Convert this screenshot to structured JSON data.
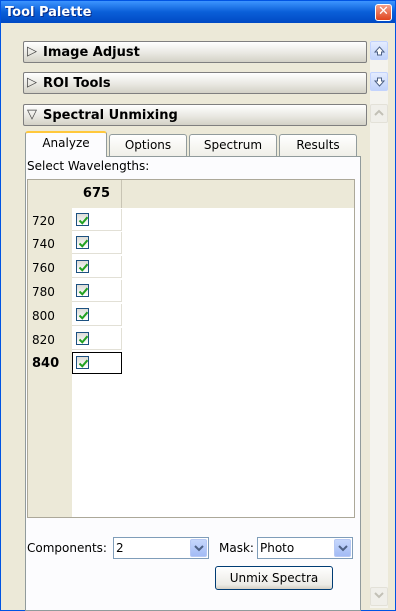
{
  "window": {
    "title": "Tool Palette",
    "close_label": "✕"
  },
  "sections": [
    {
      "label": "Image Adjust",
      "state": "collapsed"
    },
    {
      "label": "ROI Tools",
      "state": "collapsed"
    },
    {
      "label": "Spectral Unmixing",
      "state": "expanded"
    }
  ],
  "tabs": [
    {
      "label": "Analyze",
      "active": true
    },
    {
      "label": "Options",
      "active": false
    },
    {
      "label": "Spectrum",
      "active": false
    },
    {
      "label": "Results",
      "active": false
    }
  ],
  "analyze": {
    "select_label": "Select Wavelengths:",
    "column_header": "675",
    "rows": [
      {
        "label": "720",
        "checked": true
      },
      {
        "label": "740",
        "checked": true
      },
      {
        "label": "760",
        "checked": true
      },
      {
        "label": "780",
        "checked": true
      },
      {
        "label": "800",
        "checked": true
      },
      {
        "label": "820",
        "checked": true
      },
      {
        "label": "840",
        "checked": true
      }
    ],
    "components_label": "Components:",
    "components_value": "2",
    "mask_label": "Mask:",
    "mask_value": "Photo",
    "unmix_button": "Unmix Spectra"
  },
  "colors": {
    "title_bar": "#0a5fd8",
    "active_tab_accent": "#ffc83c",
    "check_mark": "#21a121"
  },
  "icons": {
    "collapsed_arrow": "▷",
    "expanded_arrow": "▽"
  }
}
